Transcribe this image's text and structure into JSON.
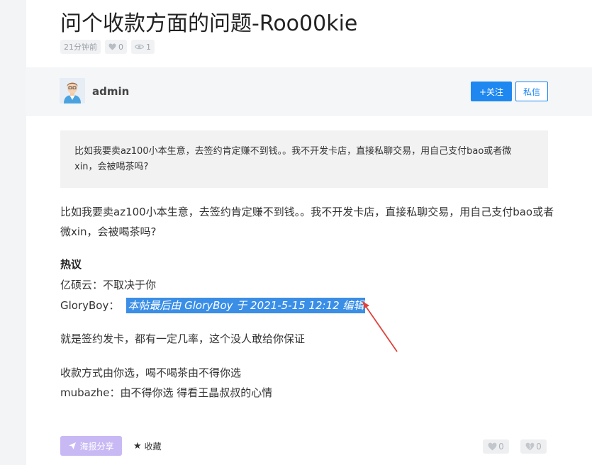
{
  "post": {
    "title": "问个收款方面的问题-Roo00kie",
    "meta": {
      "time": "21分钟前",
      "likes": "0",
      "views": "1"
    }
  },
  "author": {
    "name": "admin",
    "follow_label": "+关注",
    "message_label": "私信"
  },
  "content": {
    "quote": "比如我要卖az100小本生意，去签约肯定赚不到钱。。我不开发卡店，直接私聊交易，用自己支付bao或者微xin，会被喝茶吗?",
    "body": "比如我要卖az100小本生意，去签约肯定赚不到钱。。我不开发卡店，直接私聊交易，用自己支付bao或者微xin，会被喝茶吗?",
    "hot_title": "热议",
    "comments": [
      {
        "user": "亿硕云",
        "text": "不取决于你"
      },
      {
        "user": "GloryBoy",
        "text": "本帖最后由 GloryBoy 于 2021-5-15 12:12 编辑"
      }
    ],
    "line_a": "就是签约发卡，都有一定几率，这个没人敢给你保证",
    "line_b": "收款方式由你选，喝不喝茶由不得你选",
    "line_c": "mubazhe：由不得你选 得看王晶叔叔的心情"
  },
  "footer": {
    "share_label": "海报分享",
    "favorite_label": "收藏",
    "like_count": "0",
    "dislike_count": "0"
  },
  "colors": {
    "accent": "#1e88f0",
    "share": "#c8b9f5",
    "highlight": "#3a8ee6",
    "arrow": "#e0413a"
  }
}
